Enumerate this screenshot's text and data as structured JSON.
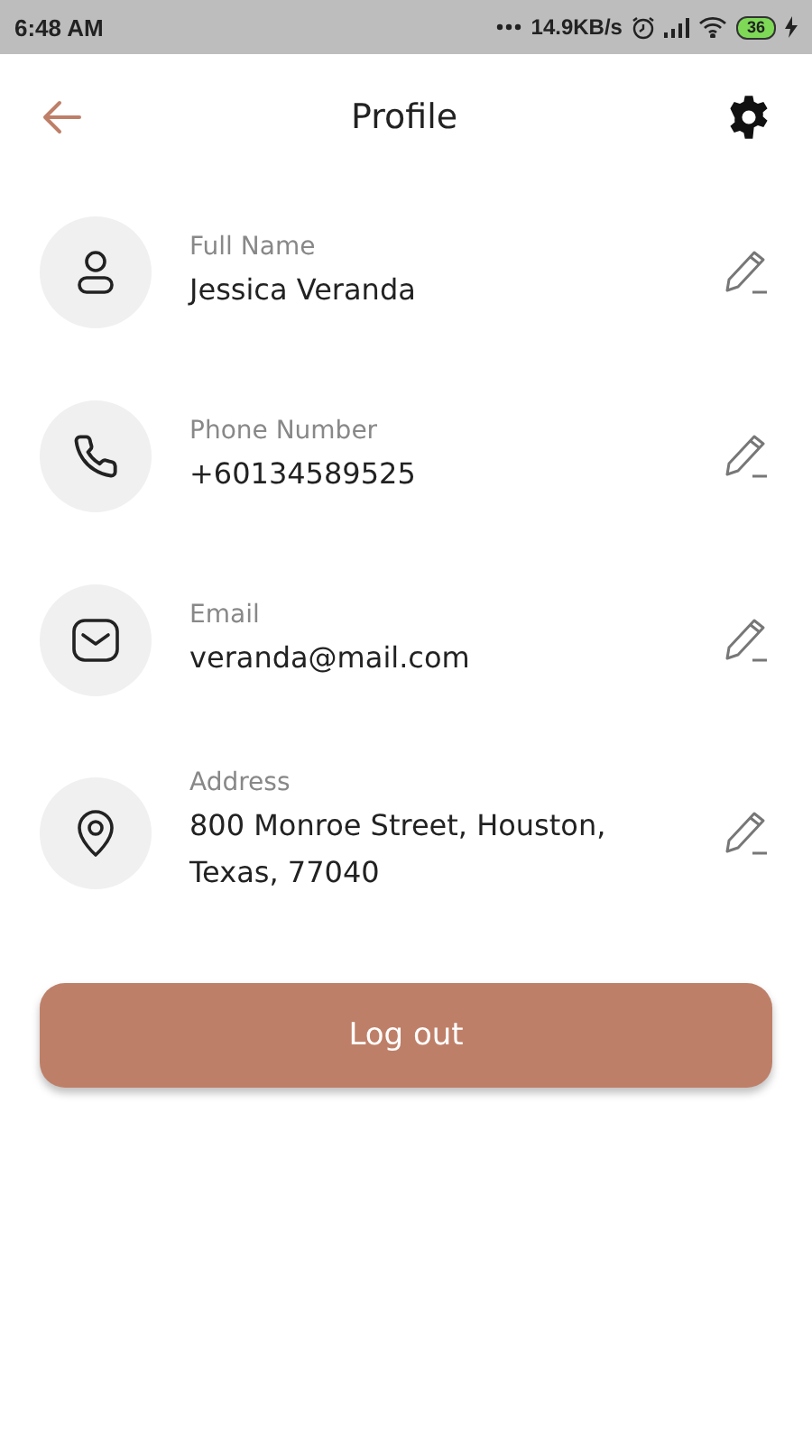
{
  "status_bar": {
    "time": "6:48 AM",
    "network_speed": "14.9KB/s",
    "battery": "36"
  },
  "header": {
    "title": "Profile"
  },
  "fields": [
    {
      "kind": "person",
      "label": "Full Name",
      "value": "Jessica Veranda"
    },
    {
      "kind": "phone",
      "label": "Phone Number",
      "value": "+60134589525"
    },
    {
      "kind": "email",
      "label": "Email",
      "value": "veranda@mail.com"
    },
    {
      "kind": "location",
      "label": "Address",
      "value": "800 Monroe Street, Houston, Texas, 77040"
    }
  ],
  "logout_button": {
    "label": "Log out"
  }
}
